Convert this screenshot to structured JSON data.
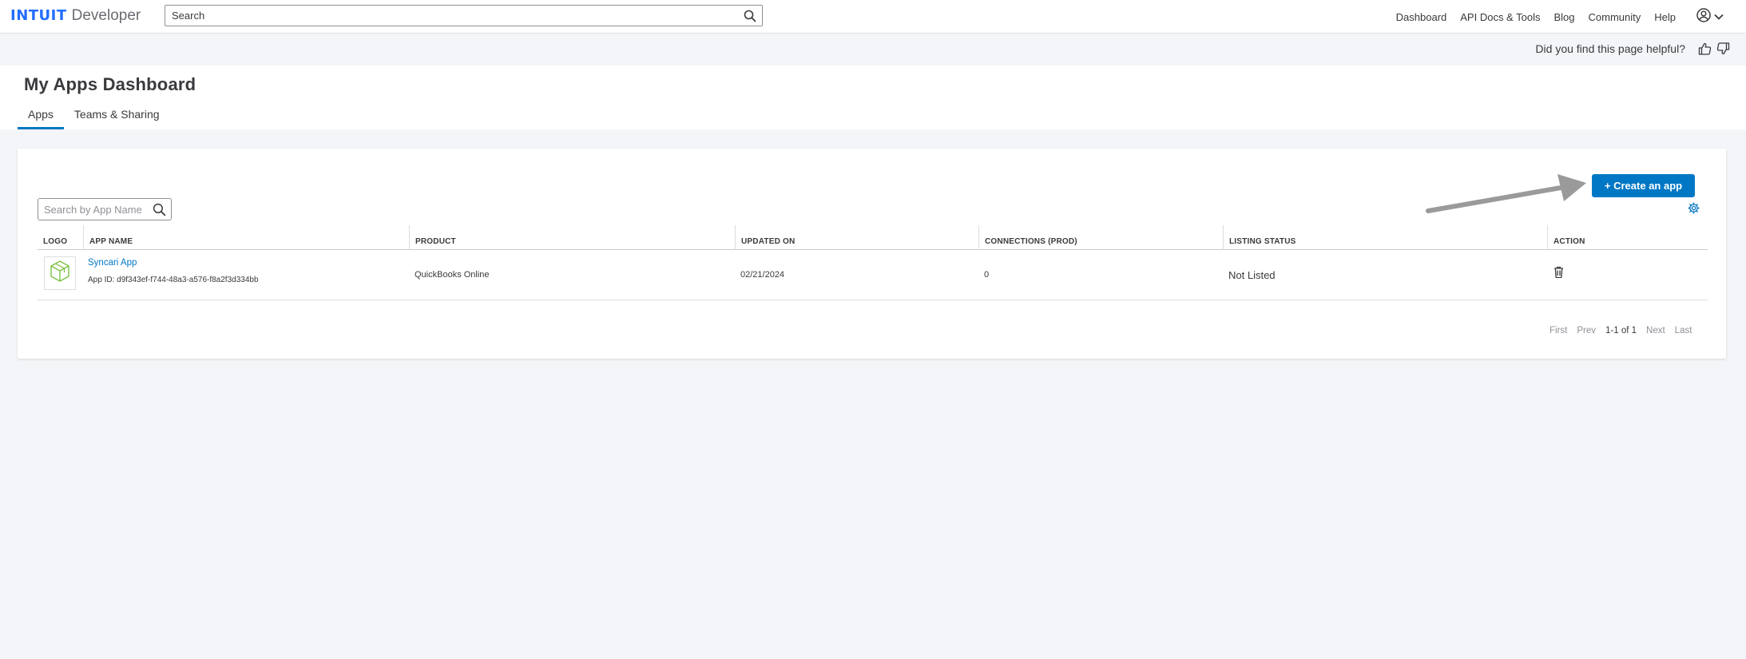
{
  "brand": {
    "intuit": "INTUIT",
    "product": "Developer"
  },
  "search": {
    "placeholder": "Search"
  },
  "nav": {
    "items": [
      "Dashboard",
      "API Docs & Tools",
      "Blog",
      "Community",
      "Help"
    ]
  },
  "feedback": {
    "question": "Did you find this page helpful?"
  },
  "page": {
    "title": "My Apps Dashboard",
    "tabs": [
      "Apps",
      "Teams & Sharing"
    ]
  },
  "toolbar": {
    "create_label": "+ Create an app",
    "app_search_placeholder": "Search by App Name"
  },
  "table": {
    "headers": [
      "LOGO",
      "APP NAME",
      "PRODUCT",
      "UPDATED ON",
      "CONNECTIONS (PROD)",
      "LISTING STATUS",
      "ACTION"
    ],
    "rows": [
      {
        "app_name": "Syncari App",
        "app_id": "App ID: d9f343ef-f744-48a3-a576-f8a2f3d334bb",
        "product": "QuickBooks Online",
        "updated_on": "02/21/2024",
        "connections": "0",
        "listing_status": "Not Listed"
      }
    ]
  },
  "pagination": {
    "first": "First",
    "prev": "Prev",
    "range": "1-1 of 1",
    "next": "Next",
    "last": "Last"
  },
  "colors": {
    "accent": "#0077c5",
    "brand": "#236cff",
    "logo_green": "#7ac143"
  }
}
